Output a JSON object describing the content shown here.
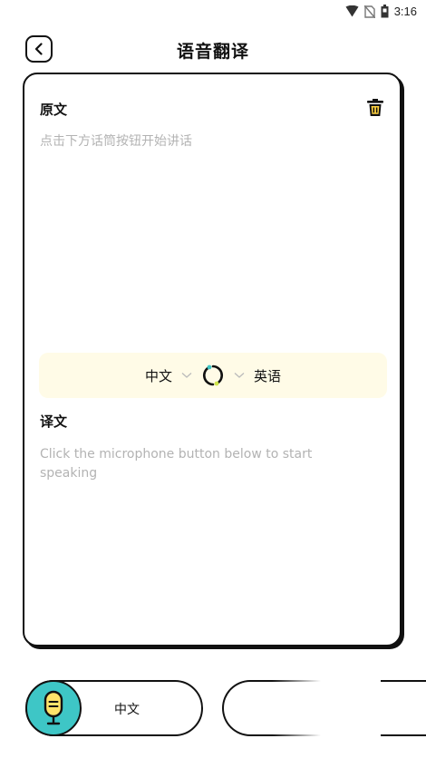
{
  "status_bar": {
    "time": "3:16"
  },
  "header": {
    "title": "语音翻译"
  },
  "source": {
    "label": "原文",
    "placeholder": "点击下方话筒按钮开始讲话"
  },
  "language_bar": {
    "from": "中文",
    "to": "英语"
  },
  "target": {
    "label": "译文",
    "placeholder_line1": "Click the microphone button below to start",
    "placeholder_line2": "speaking"
  },
  "bottom": {
    "mic_language": "中文"
  },
  "colors": {
    "accent_teal": "#3ec6c6",
    "mic_yellow": "#ffe36a",
    "lang_bar_bg": "#fffbe7",
    "swap_accent": "#cfe64a"
  }
}
